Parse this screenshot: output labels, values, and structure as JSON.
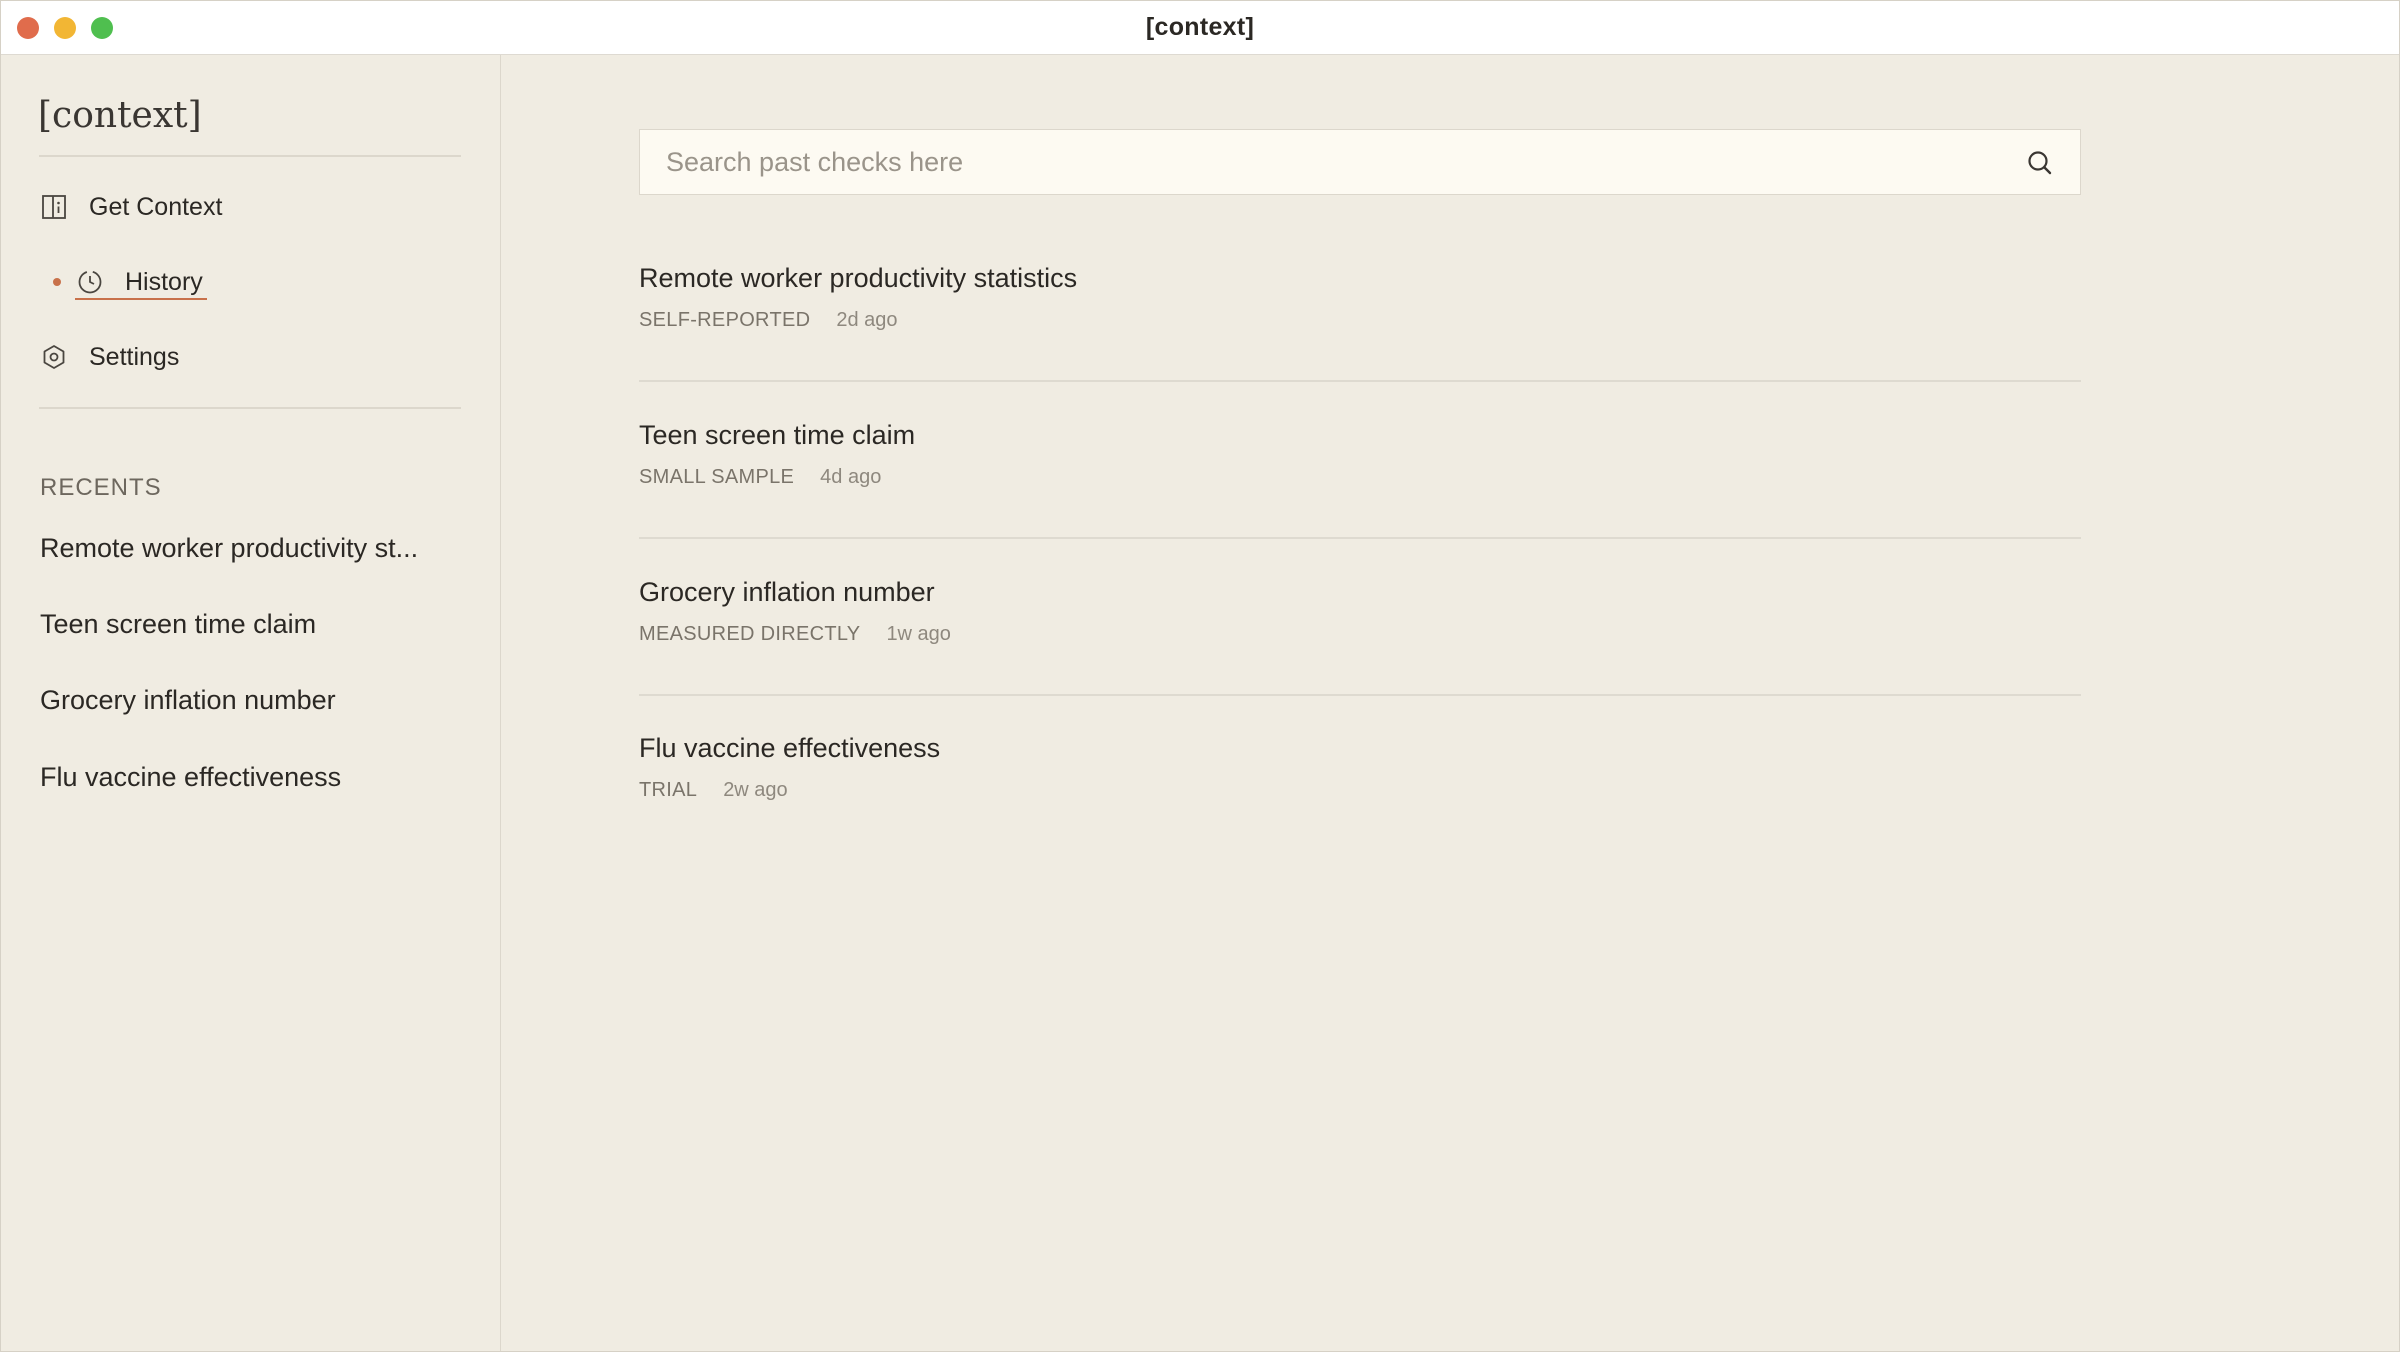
{
  "colors": {
    "close": "#e06c4c",
    "minimize": "#f2b634",
    "zoom": "#4fbf4f",
    "accent": "#c8714a"
  },
  "window": {
    "title": "[context]"
  },
  "sidebar": {
    "logo": "[context]",
    "nav": [
      {
        "label": "Get Context",
        "icon": "info-panel-icon",
        "active": false
      },
      {
        "label": "History",
        "icon": "clock-icon",
        "active": true
      },
      {
        "label": "Settings",
        "icon": "gear-icon",
        "active": false
      }
    ],
    "recents_heading": "RECENTS",
    "recents": [
      "Remote worker productivity st...",
      "Teen screen time claim",
      "Grocery inflation number",
      "Flu vaccine effectiveness"
    ]
  },
  "search": {
    "placeholder": "Search past checks here",
    "value": "",
    "icon": "search-icon"
  },
  "history": [
    {
      "title": "Remote worker productivity statistics",
      "tag": "SELF-REPORTED",
      "time": "2d ago"
    },
    {
      "title": "Teen screen time claim",
      "tag": "SMALL SAMPLE",
      "time": "4d ago"
    },
    {
      "title": "Grocery inflation number",
      "tag": "MEASURED DIRECTLY",
      "time": "1w ago"
    },
    {
      "title": "Flu vaccine effectiveness",
      "tag": "TRIAL",
      "time": "2w ago"
    }
  ]
}
